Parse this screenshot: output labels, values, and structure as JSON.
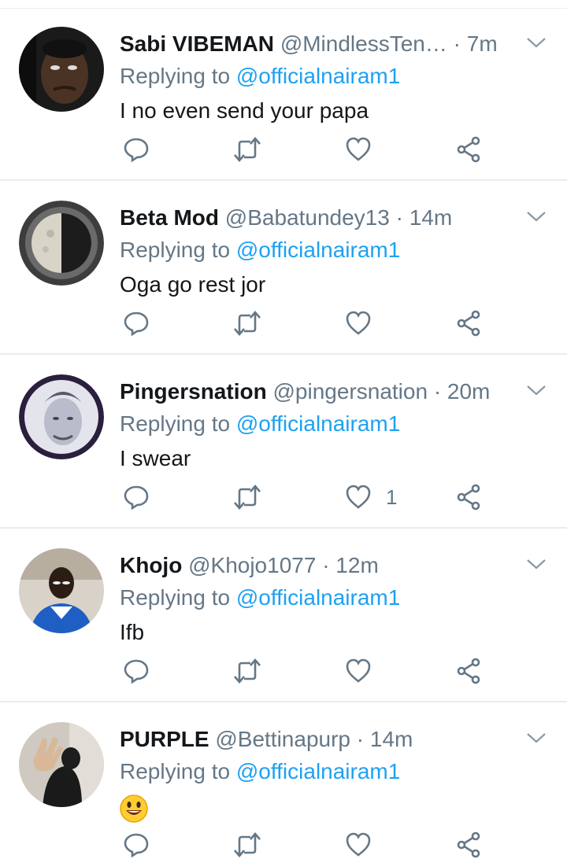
{
  "reply_prefix": "Replying to",
  "colors": {
    "link": "#1da1f2",
    "secondary": "#657786",
    "primary_text": "#14171a",
    "divider": "#e6ecf0"
  },
  "action_icons": [
    "reply-icon",
    "retweet-icon",
    "like-icon",
    "share-icon"
  ],
  "tweets": [
    {
      "name": "Sabi VIBEMAN",
      "handle": "@MindlessTen…",
      "time": "· 7m",
      "replying_to": "@officialnairam1",
      "text": "I no even send your papa",
      "likes": "",
      "avatar": "photo-man-face"
    },
    {
      "name": "Beta Mod",
      "handle": "@Babatundey13",
      "time": "· 14m",
      "replying_to": "@officialnairam1",
      "text": "Oga go rest jor",
      "likes": "",
      "avatar": "half-moon"
    },
    {
      "name": "Pingersnation",
      "handle": "@pingersnation",
      "time": "· 20m",
      "replying_to": "@officialnairam1",
      "text": "I swear",
      "likes": "1",
      "avatar": "pencil-sketch-portrait"
    },
    {
      "name": "Khojo",
      "handle": "@Khojo1077",
      "time": "· 12m",
      "replying_to": "@officialnairam1",
      "text": "Ifb",
      "likes": "",
      "avatar": "photo-man-blue-shirt"
    },
    {
      "name": "PURPLE",
      "handle": "@Bettinapurp",
      "time": "· 14m",
      "replying_to": "@officialnairam1",
      "text": "",
      "emoji": "smiling-face-emoji",
      "likes": "",
      "avatar": "photo-woman-hand"
    }
  ]
}
